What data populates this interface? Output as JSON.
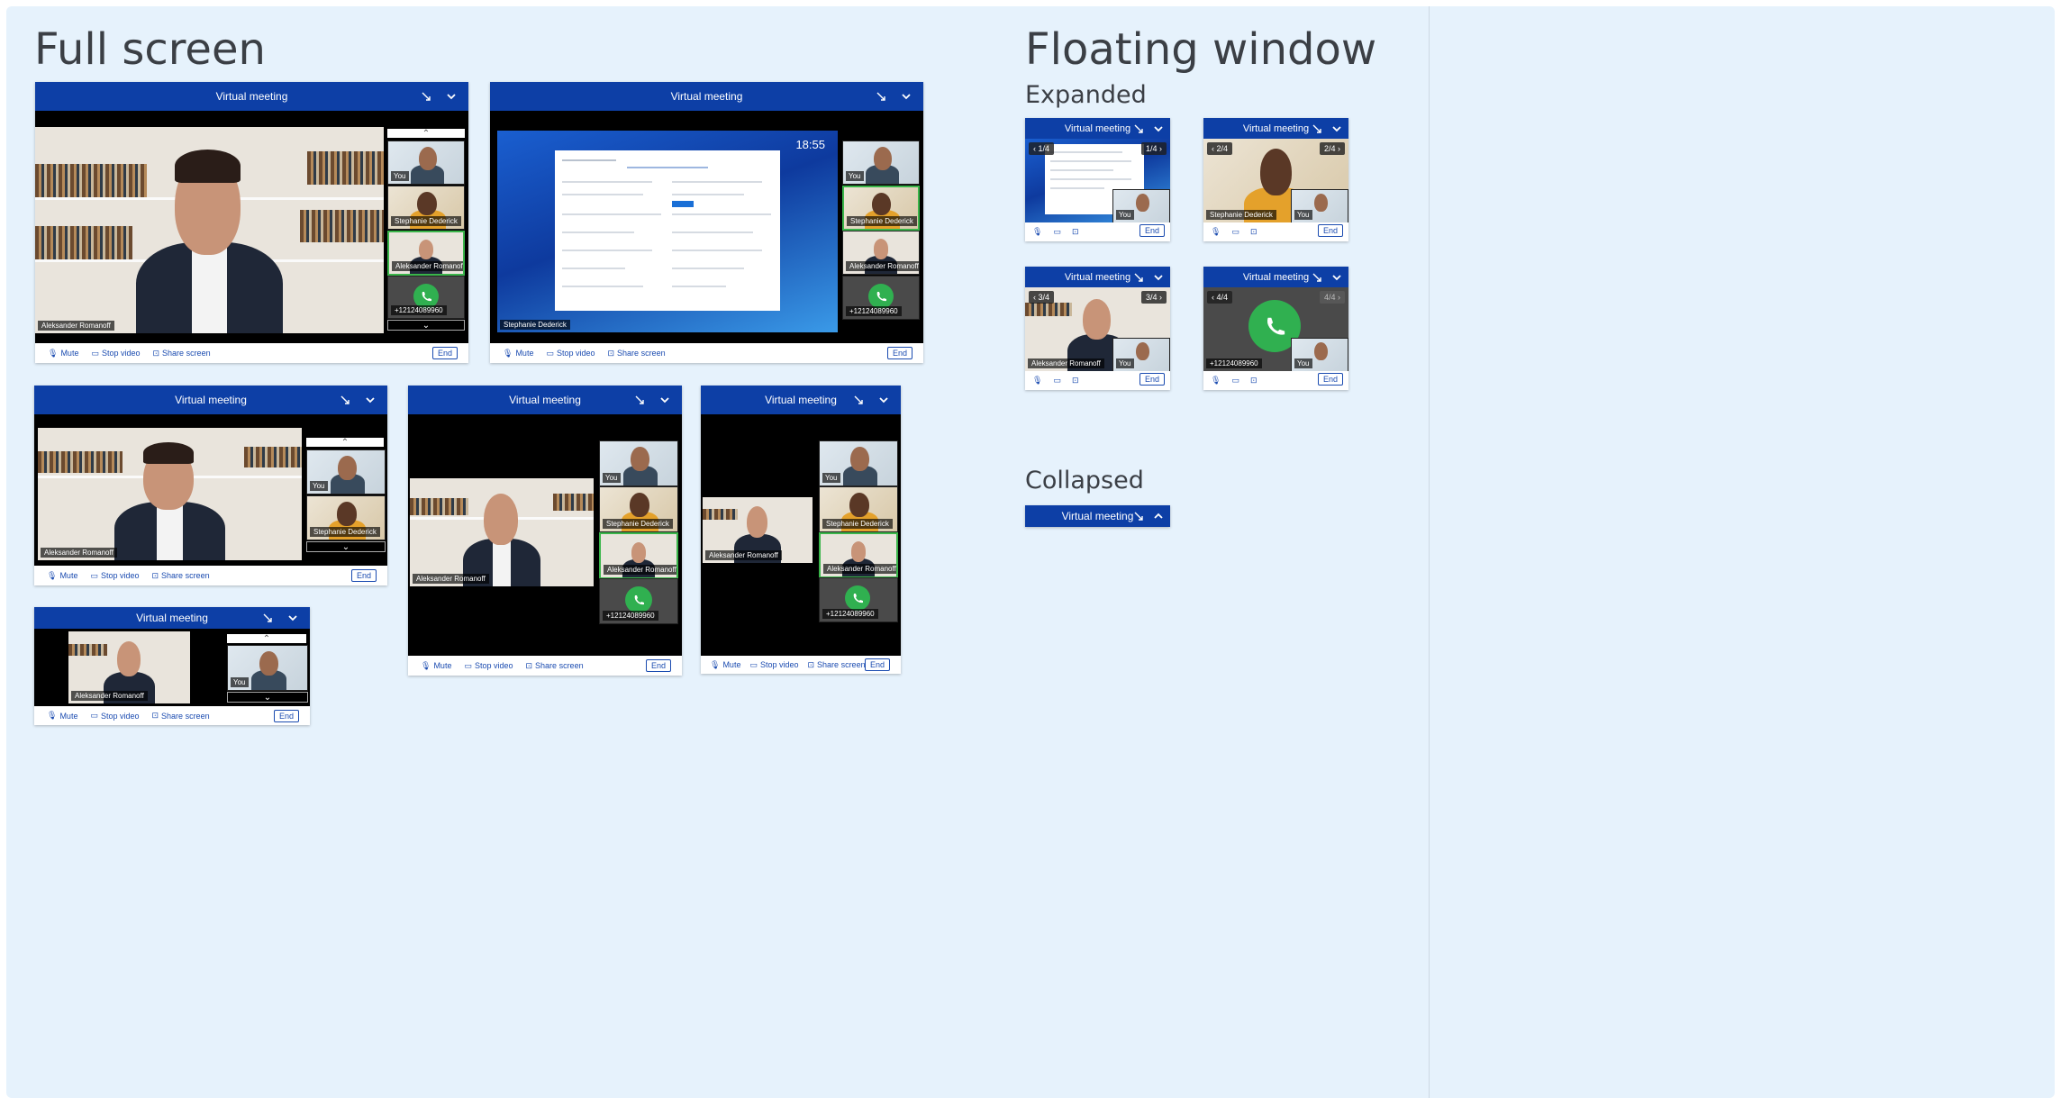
{
  "headings": {
    "full_screen": "Full screen",
    "floating_window": "Floating window",
    "expanded": "Expanded",
    "collapsed": "Collapsed"
  },
  "meeting": {
    "title": "Virtual meeting",
    "controls": {
      "mute": "Mute",
      "stop_video": "Stop video",
      "share_screen": "Share screen",
      "end": "End"
    }
  },
  "participants": {
    "main": "Aleksander Romanoff",
    "you": "You",
    "stephanie": "Stephanie Dederick",
    "phone": "+12124089960"
  },
  "screen_share": {
    "clock": "18:55"
  },
  "floating": {
    "pages": [
      "1/4",
      "2/4",
      "3/4",
      "4/4"
    ]
  },
  "colors": {
    "titlebar": "#0d3fa6",
    "accent": "#1a4bb0",
    "call_green": "#30b050",
    "active_border": "#3ab54a"
  }
}
